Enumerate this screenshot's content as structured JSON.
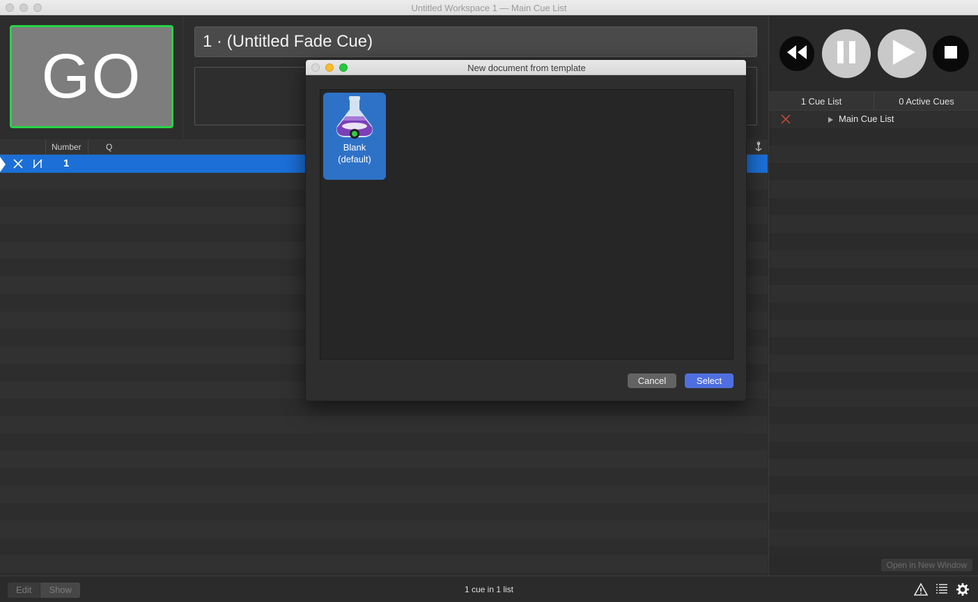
{
  "window": {
    "title": "Untitled Workspace 1 — Main Cue List"
  },
  "go_button": {
    "label": "GO"
  },
  "cue": {
    "name": "1 · (Untitled Fade Cue)",
    "notes": ""
  },
  "table": {
    "columns": [
      "Number",
      "Q"
    ],
    "rows": [
      {
        "number": "1"
      }
    ]
  },
  "transport": {
    "rewind": "rewind-icon",
    "pause": "pause-icon",
    "play": "play-icon",
    "stop": "stop-icon"
  },
  "right_tabs": {
    "cue_lists": "1 Cue List",
    "active_cues": "0 Active Cues"
  },
  "cue_lists": [
    {
      "name": "Main Cue List"
    }
  ],
  "open_new_window": "Open in New Window",
  "status": {
    "edit": "Edit",
    "show": "Show",
    "summary": "1 cue in 1 list"
  },
  "dialog": {
    "title": "New document from template",
    "templates": [
      {
        "name": "Blank",
        "subtitle": "(default)"
      }
    ],
    "cancel": "Cancel",
    "select": "Select"
  },
  "colors": {
    "go_border": "#25d545",
    "selection": "#1b6fd6",
    "select_button": "#4f6fe0",
    "disarmed_x": "#d24a3c"
  }
}
